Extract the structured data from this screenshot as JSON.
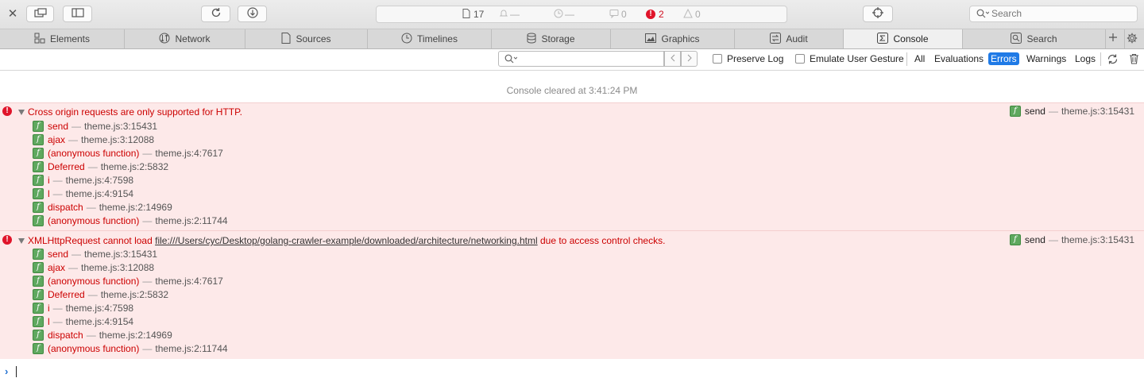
{
  "toolbar": {
    "close_glyph": "✕",
    "status": {
      "resources_count": "17",
      "network_value": "—",
      "time_value": "—",
      "logs_count": "0",
      "errors_count": "2",
      "warnings_count": "0"
    },
    "search_placeholder": "Search"
  },
  "tabs": [
    {
      "label": "Elements",
      "icon": "elements-icon"
    },
    {
      "label": "Network",
      "icon": "network-icon"
    },
    {
      "label": "Sources",
      "icon": "sources-icon"
    },
    {
      "label": "Timelines",
      "icon": "timelines-icon"
    },
    {
      "label": "Storage",
      "icon": "storage-icon"
    },
    {
      "label": "Graphics",
      "icon": "graphics-icon"
    },
    {
      "label": "Audit",
      "icon": "audit-icon"
    },
    {
      "label": "Console",
      "icon": "console-icon",
      "active": true
    },
    {
      "label": "Search",
      "icon": "search-icon"
    }
  ],
  "filterbar": {
    "filter_placeholder": "",
    "preserve_log_label": "Preserve Log",
    "emulate_gesture_label": "Emulate User Gesture",
    "levels": [
      "All",
      "Evaluations",
      "Errors",
      "Warnings",
      "Logs"
    ],
    "active_level": "Errors"
  },
  "console": {
    "cleared_text": "Console cleared at 3:41:24 PM",
    "messages": [
      {
        "text": "Cross origin requests are only supported for HTTP.",
        "source": {
          "name": "send",
          "loc": "theme.js:3:15431"
        },
        "frames": [
          {
            "name": "send",
            "loc": "theme.js:3:15431"
          },
          {
            "name": "ajax",
            "loc": "theme.js:3:12088"
          },
          {
            "name": "(anonymous function)",
            "loc": "theme.js:4:7617"
          },
          {
            "name": "Deferred",
            "loc": "theme.js:2:5832"
          },
          {
            "name": "i",
            "loc": "theme.js:4:7598"
          },
          {
            "name": "l",
            "loc": "theme.js:4:9154"
          },
          {
            "name": "dispatch",
            "loc": "theme.js:2:14969"
          },
          {
            "name": "(anonymous function)",
            "loc": "theme.js:2:11744"
          }
        ]
      },
      {
        "text_before": "XMLHttpRequest cannot load ",
        "url": "file:///Users/cyc/Desktop/golang-crawler-example/downloaded/architecture/networking.html",
        "text_after": " due to access control checks.",
        "source": {
          "name": "send",
          "loc": "theme.js:3:15431"
        },
        "frames": [
          {
            "name": "send",
            "loc": "theme.js:3:15431"
          },
          {
            "name": "ajax",
            "loc": "theme.js:3:12088"
          },
          {
            "name": "(anonymous function)",
            "loc": "theme.js:4:7617"
          },
          {
            "name": "Deferred",
            "loc": "theme.js:2:5832"
          },
          {
            "name": "i",
            "loc": "theme.js:4:7598"
          },
          {
            "name": "l",
            "loc": "theme.js:4:9154"
          },
          {
            "name": "dispatch",
            "loc": "theme.js:2:14969"
          },
          {
            "name": "(anonymous function)",
            "loc": "theme.js:2:11744"
          }
        ]
      }
    ],
    "frame_badge": "f",
    "separator": "—",
    "error_glyph": "!"
  },
  "colors": {
    "error_text": "#cc0000",
    "error_bg": "#fde9e9",
    "active_level_bg": "#1f7ae6",
    "badge_green": "#5fa85f"
  }
}
